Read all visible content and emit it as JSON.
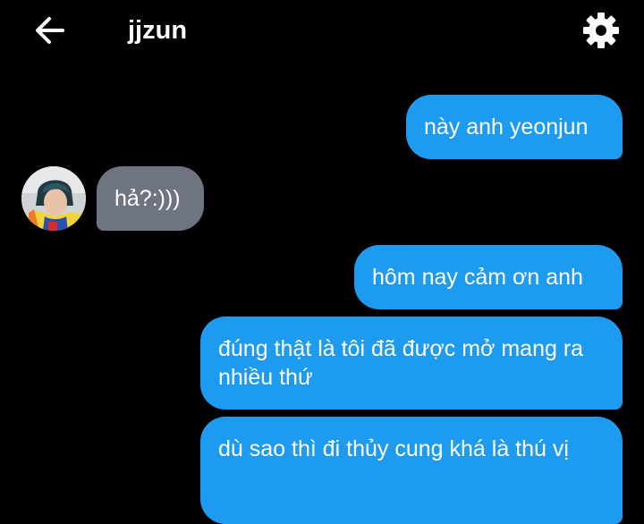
{
  "header": {
    "back_icon": "arrow-left-icon",
    "title": "jjzun",
    "settings_icon": "gear-icon"
  },
  "colors": {
    "background": "#000000",
    "outgoing_bubble": "#1d9bf0",
    "incoming_bubble": "#6e7480",
    "text": "#ffffff"
  },
  "messages": [
    {
      "direction": "outgoing",
      "text": "này anh yeonjun"
    },
    {
      "direction": "incoming",
      "text": "hả?:)))"
    },
    {
      "direction": "outgoing",
      "text": "hôm nay cảm ơn anh"
    },
    {
      "direction": "outgoing",
      "text": "đúng thật là tôi đã được mở mang ra nhiều thứ"
    },
    {
      "direction": "outgoing",
      "text": "dù sao thì đi thủy cung khá là thú vị"
    }
  ]
}
